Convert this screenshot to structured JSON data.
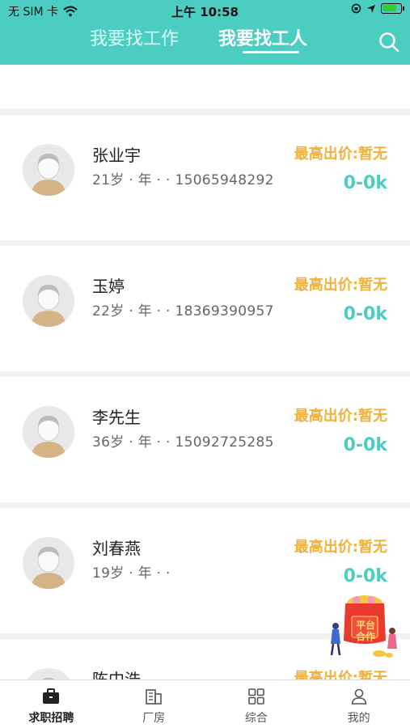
{
  "status_bar": {
    "carrier": "无 SIM 卡",
    "time": "上午 10:58"
  },
  "tabs": [
    {
      "label": "我要找工作"
    },
    {
      "label": "我要找工人"
    }
  ],
  "workers": [
    {
      "name": "张业宇",
      "info": "21岁 · 年 · · 15065948292",
      "price_label": "最高出价:暂无",
      "price": "0-0k"
    },
    {
      "name": "玉婷",
      "info": "22岁 · 年 · · 18369390957",
      "price_label": "最高出价:暂无",
      "price": "0-0k"
    },
    {
      "name": "李先生",
      "info": "36岁 · 年 · · 15092725285",
      "price_label": "最高出价:暂无",
      "price": "0-0k"
    },
    {
      "name": "刘春燕",
      "info": "19岁 · 年 · ·",
      "price_label": "最高出价:暂无",
      "price": "0-0k"
    },
    {
      "name": "陈中浩",
      "price_label": "最高出价:暂无"
    }
  ],
  "float_badge": {
    "line1": "平台",
    "line2": "合作"
  },
  "bottom_nav": [
    {
      "label": "求职招聘",
      "icon": "briefcase-icon"
    },
    {
      "label": "厂房",
      "icon": "building-icon"
    },
    {
      "label": "综合",
      "icon": "grid-icon"
    },
    {
      "label": "我的",
      "icon": "user-icon"
    }
  ],
  "colors": {
    "accent": "#4ccdc2",
    "price_label": "#f0b23a"
  }
}
